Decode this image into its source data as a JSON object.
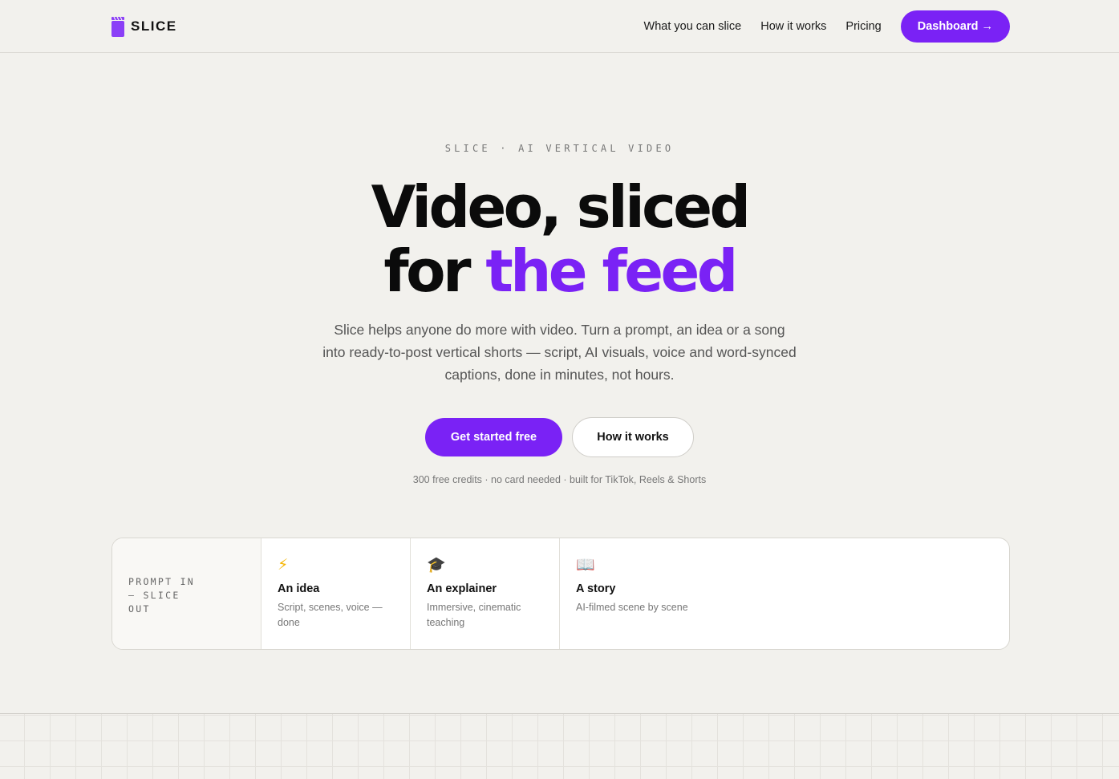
{
  "brand": {
    "name": "SLICE",
    "logo_icon": "clapperboard-icon",
    "accent_color": "#7a22f5"
  },
  "nav": {
    "links": [
      "What you can slice",
      "How it works",
      "Pricing"
    ],
    "cta_label": "Dashboard →"
  },
  "hero": {
    "eyebrow": "SLICE · AI VERTICAL VIDEO",
    "headline_line1": "Video, sliced",
    "headline_line2_plain": "for ",
    "headline_line2_accent": "the feed",
    "subcopy": "Slice helps anyone do more with video. Turn a prompt, an idea or a song into ready-to-post vertical shorts — script, AI visuals, voice and word-synced captions, done in minutes, not hours.",
    "primary_cta": "Get started free",
    "secondary_cta": "How it works",
    "fineprint": "300 free credits · no card needed · built for TikTok, Reels & Shorts"
  },
  "strip": {
    "lead": "PROMPT IN\n— SLICE\nOUT",
    "cards": [
      {
        "icon": "⚡",
        "icon_name": "lightning-icon",
        "title": "An idea",
        "desc": "Script, scenes, voice — done"
      },
      {
        "icon": "🎓",
        "icon_name": "graduation-cap-icon",
        "title": "An explainer",
        "desc": "Immersive, cinematic teaching"
      },
      {
        "icon": "📖",
        "icon_name": "open-book-icon",
        "title": "A story",
        "desc": "AI-filmed scene by scene"
      }
    ]
  }
}
